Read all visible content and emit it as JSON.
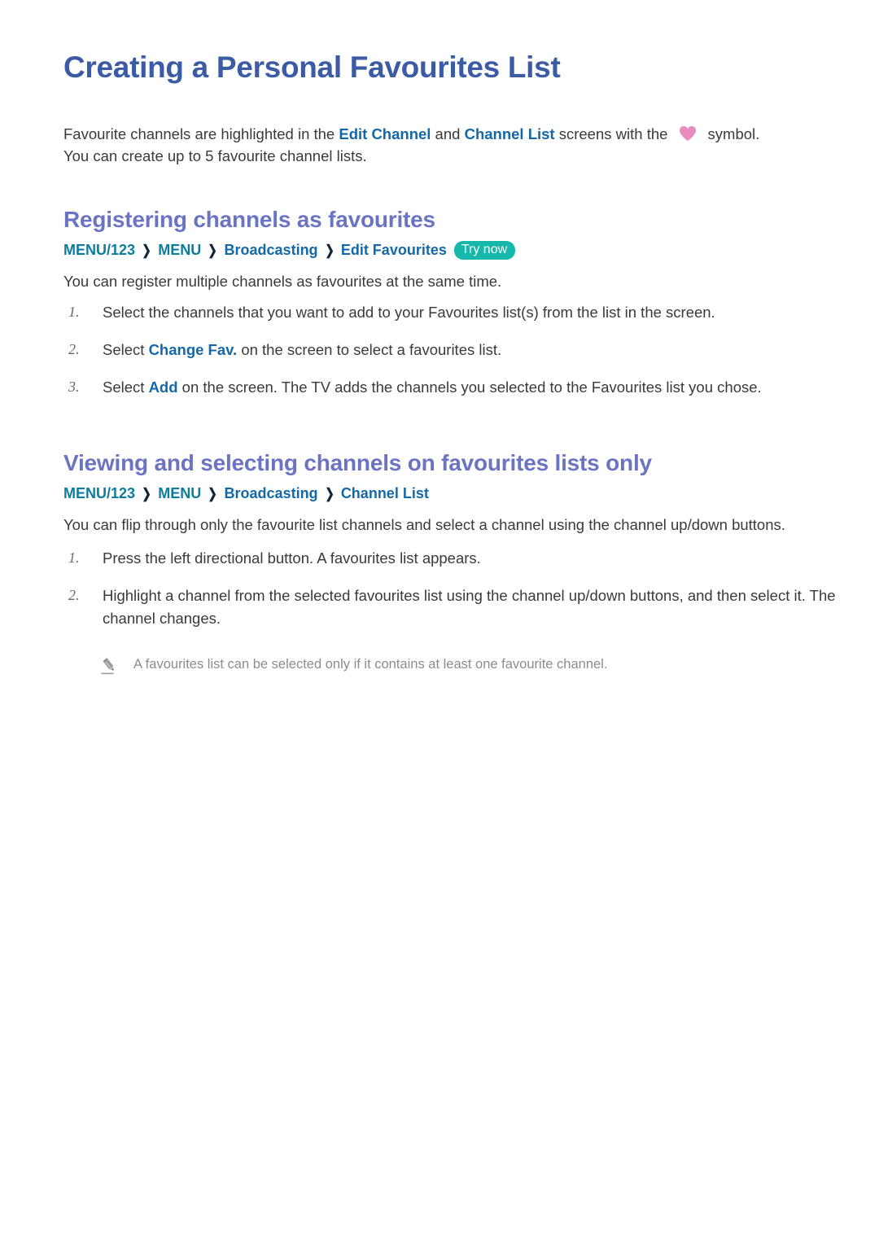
{
  "page": {
    "title": "Creating a Personal Favourites List",
    "intro": {
      "before_edit_channel": "Favourite channels are highlighted in the ",
      "edit_channel": "Edit Channel",
      "between_links": " and ",
      "channel_list": "Channel List",
      "after_links": " screens with the ",
      "heart_icon": "heart-icon",
      "after_heart": "symbol.",
      "line2": "You can create up to 5 favourite channel lists."
    }
  },
  "sections": [
    {
      "heading": "Registering channels as favourites",
      "breadcrumb": {
        "items": [
          "MENU/123",
          "MENU",
          "Broadcasting",
          "Edit Favourites"
        ],
        "separator": "❯",
        "badge": "Try now"
      },
      "lead": "You can register multiple channels as favourites at the same time.",
      "steps": [
        {
          "number": "1.",
          "pre": "Select the channels that you want to add to your Favourites list(s) from the list in the screen.",
          "link": "",
          "post": ""
        },
        {
          "number": "2.",
          "pre": "Select ",
          "link": "Change Fav.",
          "post": " on the screen to select a favourites list."
        },
        {
          "number": "3.",
          "pre": "Select ",
          "link": "Add",
          "post": " on the screen. The TV adds the channels you selected to the Favourites list you chose."
        }
      ],
      "note": null
    },
    {
      "heading": "Viewing and selecting channels on favourites lists only",
      "breadcrumb": {
        "items": [
          "MENU/123",
          "MENU",
          "Broadcasting",
          "Channel List"
        ],
        "separator": "❯",
        "badge": ""
      },
      "lead": "You can flip through only the favourite list channels and select a channel using the channel up/down buttons.",
      "steps": [
        {
          "number": "1.",
          "pre": "Press the left directional button. A favourites list appears.",
          "link": "",
          "post": ""
        },
        {
          "number": "2.",
          "pre": "Highlight a channel from the selected favourites list using the channel up/down buttons, and then select it. The channel changes.",
          "link": "",
          "post": ""
        }
      ],
      "note": {
        "icon": "pencil-icon",
        "text": "A favourites list can be selected only if it contains at least one favourite channel."
      }
    }
  ],
  "colors": {
    "title_blue": "#3b5ba4",
    "heading_periwinkle": "#6a74c2",
    "link_blue": "#1468a8",
    "breadcrumb_teal": "#0d7d9c",
    "badge_teal": "#17b8ac",
    "heart_pink": "#e88cbd",
    "note_gray": "#8c8c8c",
    "body_text": "#3a3a3a"
  }
}
